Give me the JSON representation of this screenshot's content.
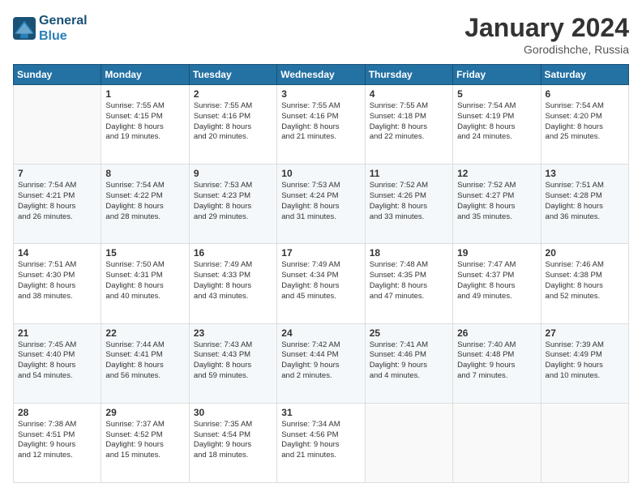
{
  "logo": {
    "line1": "General",
    "line2": "Blue"
  },
  "title": "January 2024",
  "location": "Gorodishche, Russia",
  "days_header": [
    "Sunday",
    "Monday",
    "Tuesday",
    "Wednesday",
    "Thursday",
    "Friday",
    "Saturday"
  ],
  "weeks": [
    [
      {
        "day": "",
        "sunrise": "",
        "sunset": "",
        "daylight": ""
      },
      {
        "day": "1",
        "sunrise": "Sunrise: 7:55 AM",
        "sunset": "Sunset: 4:15 PM",
        "daylight": "Daylight: 8 hours and 19 minutes."
      },
      {
        "day": "2",
        "sunrise": "Sunrise: 7:55 AM",
        "sunset": "Sunset: 4:16 PM",
        "daylight": "Daylight: 8 hours and 20 minutes."
      },
      {
        "day": "3",
        "sunrise": "Sunrise: 7:55 AM",
        "sunset": "Sunset: 4:16 PM",
        "daylight": "Daylight: 8 hours and 21 minutes."
      },
      {
        "day": "4",
        "sunrise": "Sunrise: 7:55 AM",
        "sunset": "Sunset: 4:18 PM",
        "daylight": "Daylight: 8 hours and 22 minutes."
      },
      {
        "day": "5",
        "sunrise": "Sunrise: 7:54 AM",
        "sunset": "Sunset: 4:19 PM",
        "daylight": "Daylight: 8 hours and 24 minutes."
      },
      {
        "day": "6",
        "sunrise": "Sunrise: 7:54 AM",
        "sunset": "Sunset: 4:20 PM",
        "daylight": "Daylight: 8 hours and 25 minutes."
      }
    ],
    [
      {
        "day": "7",
        "sunrise": "Sunrise: 7:54 AM",
        "sunset": "Sunset: 4:21 PM",
        "daylight": "Daylight: 8 hours and 26 minutes."
      },
      {
        "day": "8",
        "sunrise": "Sunrise: 7:54 AM",
        "sunset": "Sunset: 4:22 PM",
        "daylight": "Daylight: 8 hours and 28 minutes."
      },
      {
        "day": "9",
        "sunrise": "Sunrise: 7:53 AM",
        "sunset": "Sunset: 4:23 PM",
        "daylight": "Daylight: 8 hours and 29 minutes."
      },
      {
        "day": "10",
        "sunrise": "Sunrise: 7:53 AM",
        "sunset": "Sunset: 4:24 PM",
        "daylight": "Daylight: 8 hours and 31 minutes."
      },
      {
        "day": "11",
        "sunrise": "Sunrise: 7:52 AM",
        "sunset": "Sunset: 4:26 PM",
        "daylight": "Daylight: 8 hours and 33 minutes."
      },
      {
        "day": "12",
        "sunrise": "Sunrise: 7:52 AM",
        "sunset": "Sunset: 4:27 PM",
        "daylight": "Daylight: 8 hours and 35 minutes."
      },
      {
        "day": "13",
        "sunrise": "Sunrise: 7:51 AM",
        "sunset": "Sunset: 4:28 PM",
        "daylight": "Daylight: 8 hours and 36 minutes."
      }
    ],
    [
      {
        "day": "14",
        "sunrise": "Sunrise: 7:51 AM",
        "sunset": "Sunset: 4:30 PM",
        "daylight": "Daylight: 8 hours and 38 minutes."
      },
      {
        "day": "15",
        "sunrise": "Sunrise: 7:50 AM",
        "sunset": "Sunset: 4:31 PM",
        "daylight": "Daylight: 8 hours and 40 minutes."
      },
      {
        "day": "16",
        "sunrise": "Sunrise: 7:49 AM",
        "sunset": "Sunset: 4:33 PM",
        "daylight": "Daylight: 8 hours and 43 minutes."
      },
      {
        "day": "17",
        "sunrise": "Sunrise: 7:49 AM",
        "sunset": "Sunset: 4:34 PM",
        "daylight": "Daylight: 8 hours and 45 minutes."
      },
      {
        "day": "18",
        "sunrise": "Sunrise: 7:48 AM",
        "sunset": "Sunset: 4:35 PM",
        "daylight": "Daylight: 8 hours and 47 minutes."
      },
      {
        "day": "19",
        "sunrise": "Sunrise: 7:47 AM",
        "sunset": "Sunset: 4:37 PM",
        "daylight": "Daylight: 8 hours and 49 minutes."
      },
      {
        "day": "20",
        "sunrise": "Sunrise: 7:46 AM",
        "sunset": "Sunset: 4:38 PM",
        "daylight": "Daylight: 8 hours and 52 minutes."
      }
    ],
    [
      {
        "day": "21",
        "sunrise": "Sunrise: 7:45 AM",
        "sunset": "Sunset: 4:40 PM",
        "daylight": "Daylight: 8 hours and 54 minutes."
      },
      {
        "day": "22",
        "sunrise": "Sunrise: 7:44 AM",
        "sunset": "Sunset: 4:41 PM",
        "daylight": "Daylight: 8 hours and 56 minutes."
      },
      {
        "day": "23",
        "sunrise": "Sunrise: 7:43 AM",
        "sunset": "Sunset: 4:43 PM",
        "daylight": "Daylight: 8 hours and 59 minutes."
      },
      {
        "day": "24",
        "sunrise": "Sunrise: 7:42 AM",
        "sunset": "Sunset: 4:44 PM",
        "daylight": "Daylight: 9 hours and 2 minutes."
      },
      {
        "day": "25",
        "sunrise": "Sunrise: 7:41 AM",
        "sunset": "Sunset: 4:46 PM",
        "daylight": "Daylight: 9 hours and 4 minutes."
      },
      {
        "day": "26",
        "sunrise": "Sunrise: 7:40 AM",
        "sunset": "Sunset: 4:48 PM",
        "daylight": "Daylight: 9 hours and 7 minutes."
      },
      {
        "day": "27",
        "sunrise": "Sunrise: 7:39 AM",
        "sunset": "Sunset: 4:49 PM",
        "daylight": "Daylight: 9 hours and 10 minutes."
      }
    ],
    [
      {
        "day": "28",
        "sunrise": "Sunrise: 7:38 AM",
        "sunset": "Sunset: 4:51 PM",
        "daylight": "Daylight: 9 hours and 12 minutes."
      },
      {
        "day": "29",
        "sunrise": "Sunrise: 7:37 AM",
        "sunset": "Sunset: 4:52 PM",
        "daylight": "Daylight: 9 hours and 15 minutes."
      },
      {
        "day": "30",
        "sunrise": "Sunrise: 7:35 AM",
        "sunset": "Sunset: 4:54 PM",
        "daylight": "Daylight: 9 hours and 18 minutes."
      },
      {
        "day": "31",
        "sunrise": "Sunrise: 7:34 AM",
        "sunset": "Sunset: 4:56 PM",
        "daylight": "Daylight: 9 hours and 21 minutes."
      },
      {
        "day": "",
        "sunrise": "",
        "sunset": "",
        "daylight": ""
      },
      {
        "day": "",
        "sunrise": "",
        "sunset": "",
        "daylight": ""
      },
      {
        "day": "",
        "sunrise": "",
        "sunset": "",
        "daylight": ""
      }
    ]
  ]
}
